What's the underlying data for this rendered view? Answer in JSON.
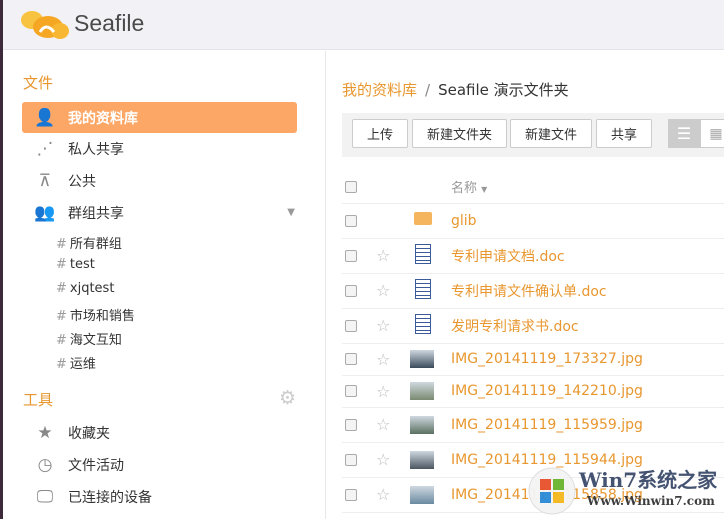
{
  "app": {
    "logo_text": "Seafile"
  },
  "sidebar": {
    "files_heading": "文件",
    "items": [
      {
        "label": "我的资料库",
        "icon": "user-icon"
      },
      {
        "label": "私人共享",
        "icon": "share-icon"
      },
      {
        "label": "公共",
        "icon": "org-icon"
      },
      {
        "label": "群组共享",
        "icon": "group-icon"
      }
    ],
    "groups": [
      "所有群组",
      "test",
      "xjqtest",
      "市场和销售",
      "海文互知",
      "运维"
    ],
    "tools_heading": "工具",
    "tools": [
      {
        "label": "收藏夹",
        "icon": "star-icon"
      },
      {
        "label": "文件活动",
        "icon": "history-icon"
      },
      {
        "label": "已连接的设备",
        "icon": "monitor-icon"
      }
    ]
  },
  "breadcrumb": {
    "root": "我的资料库",
    "sep": "/",
    "current": "Seafile 演示文件夹"
  },
  "toolbar": {
    "upload": "上传",
    "new_folder": "新建文件夹",
    "new_file": "新建文件",
    "share": "共享"
  },
  "table": {
    "name_header": "名称",
    "rows": [
      {
        "name": "glib",
        "type": "folder"
      },
      {
        "name": "专利申请文档.doc",
        "type": "doc"
      },
      {
        "name": "专利申请文件确认单.doc",
        "type": "doc"
      },
      {
        "name": "发明专利请求书.doc",
        "type": "doc"
      },
      {
        "name": "IMG_20141119_173327.jpg",
        "type": "img",
        "color": "#3a4a5a"
      },
      {
        "name": "IMG_20141119_142210.jpg",
        "type": "img",
        "color": "#7a8a70"
      },
      {
        "name": "IMG_20141119_115959.jpg",
        "type": "img",
        "color": "#5a7060"
      },
      {
        "name": "IMG_20141119_115944.jpg",
        "type": "img",
        "color": "#4a5560"
      },
      {
        "name": "IMG_20141119_115858.jpg",
        "type": "img",
        "color": "#6a8aa0"
      }
    ]
  },
  "watermark": {
    "title": "Win7系统之家",
    "url": "Www.Winwin7.com"
  },
  "colors": {
    "accent": "#e8972f",
    "active": "#fda767"
  }
}
